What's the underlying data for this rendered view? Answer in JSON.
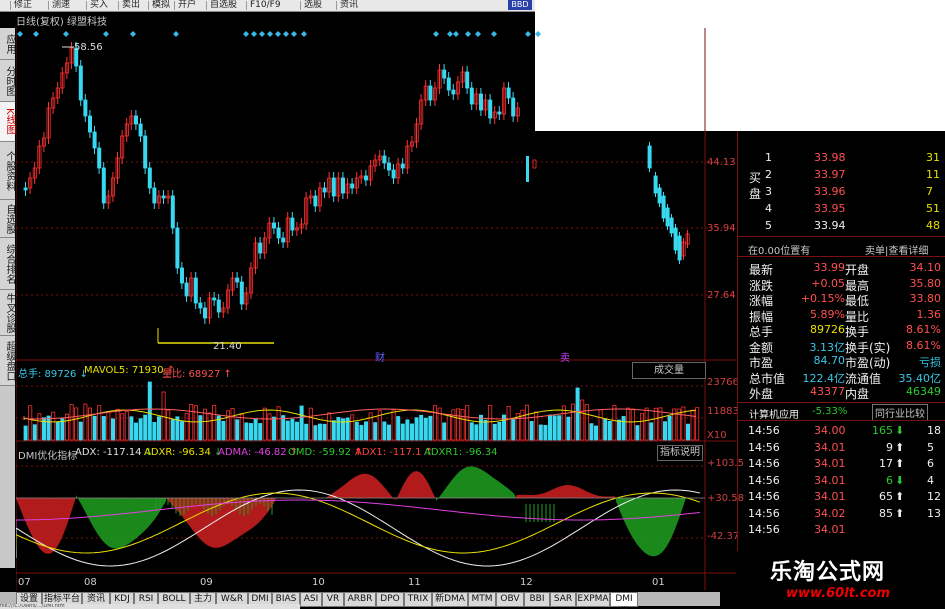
{
  "toolbar": {
    "items": [
      "修正",
      "测速",
      "买入",
      "卖出",
      "模拟",
      "开户",
      "自选股",
      "F10/F9",
      "选股",
      "资讯"
    ],
    "badge": "BBD"
  },
  "left_tabs": [
    "应用",
    "分时图",
    "K线图",
    "个股资料",
    "自选股",
    "综合排名",
    "牛叉诊股",
    "超级盘口"
  ],
  "chart": {
    "title": "日线(复权) 绿盟科技",
    "high_marker": "58.56",
    "low_marker": "21.40",
    "price_labels": [
      "44.13",
      "35.94",
      "27.64"
    ],
    "tag_cai": "财",
    "tag_sell": "卖"
  },
  "volume": {
    "total_label": "总手: 89726",
    "mavol_label": "MAVOL5: 71930",
    "ratio_label": "量比: 68927",
    "button": "成交量",
    "axis": [
      "23766",
      "11883",
      "X10"
    ]
  },
  "indicator": {
    "name": "DMI优化指标",
    "adx": "ADX: -117.14",
    "adxr": "ADXR: -96.34",
    "adma": "ADMA: -46.82",
    "omd": "OMD: -59.92",
    "adx1": "ADX1: -117.1",
    "adxr1": "ADXR1: -96.34",
    "button": "指标说明",
    "axis": [
      "+103.5",
      "+30.58",
      "-42.37"
    ]
  },
  "x_labels": [
    "07",
    "08",
    "09",
    "10",
    "11",
    "12",
    "01"
  ],
  "bottom_tabs": [
    "设置",
    "指标平台",
    "资讯",
    "KDJ",
    "RSI",
    "BOLL",
    "主力",
    "W&R",
    "DMI",
    "BIAS",
    "ASI",
    "VR",
    "ARBR",
    "DPO",
    "TRIX",
    "新DMA",
    "MTM",
    "OBV",
    "BBI",
    "SAR",
    "EXPMA",
    "DMI优"
  ],
  "order_book": {
    "side_label": "买盘",
    "rows": [
      {
        "n": "1",
        "price": "33.98",
        "qty": "31"
      },
      {
        "n": "2",
        "price": "33.97",
        "qty": "11"
      },
      {
        "n": "3",
        "price": "33.96",
        "qty": "7"
      },
      {
        "n": "4",
        "price": "33.95",
        "qty": "51"
      },
      {
        "n": "5",
        "price": "33.94",
        "qty": "48"
      }
    ],
    "pos_label": "在0.00位置有",
    "pos_btn": "卖单|查看详细"
  },
  "quote": {
    "rows": [
      {
        "l1": "最新",
        "v1": "33.99",
        "l2": "开盘",
        "v2": "34.10"
      },
      {
        "l1": "涨跌",
        "v1": "+0.05",
        "l2": "最高",
        "v2": "35.80"
      },
      {
        "l1": "涨幅",
        "v1": "+0.15%",
        "l2": "最低",
        "v2": "33.80"
      },
      {
        "l1": "振幅",
        "v1": "5.89%",
        "l2": "量比",
        "v2": "1.36"
      },
      {
        "l1": "总手",
        "v1": "89726",
        "l2": "换手",
        "v2": "8.61%"
      },
      {
        "l1": "金额",
        "v1": "3.13亿",
        "l2": "换手(实)",
        "v2": "8.61%"
      },
      {
        "l1": "市盈",
        "v1": "84.70",
        "l2": "市盈(动)",
        "v2": "亏损"
      },
      {
        "l1": "总市值",
        "v1": "122.4亿",
        "l2": "流通值",
        "v2": "35.40亿"
      },
      {
        "l1": "外盘",
        "v1": "43377",
        "l2": "内盘",
        "v2": "46349"
      }
    ],
    "sector_name": "计算机应用",
    "sector_change": "-5.33%",
    "compare_btn": "同行业比较"
  },
  "ticks": [
    {
      "time": "14:56",
      "price": "34.00",
      "vol": "165",
      "dir": "down",
      "n": "18"
    },
    {
      "time": "14:56",
      "price": "34.01",
      "vol": "9",
      "dir": "up",
      "n": "5"
    },
    {
      "time": "14:56",
      "price": "34.01",
      "vol": "17",
      "dir": "up",
      "n": "6"
    },
    {
      "time": "14:56",
      "price": "34.01",
      "vol": "6",
      "dir": "down",
      "n": "4"
    },
    {
      "time": "14:56",
      "price": "34.01",
      "vol": "65",
      "dir": "up",
      "n": "12"
    },
    {
      "time": "14:56",
      "price": "34.02",
      "vol": "85",
      "dir": "up",
      "n": "13"
    },
    {
      "time": "14:56",
      "price": "34.01",
      "vol": "",
      "dir": "",
      "n": ""
    }
  ],
  "watermark": {
    "title": "乐淘公式网",
    "url": "www.60lt.com"
  },
  "url_bar": "file:///C:/Users/.../DMI.htm",
  "colors": {
    "up": "#ff3030",
    "down": "#38d8f0",
    "grid": "#7a1010",
    "yellow": "#e8e000",
    "green": "#2ec82e"
  }
}
